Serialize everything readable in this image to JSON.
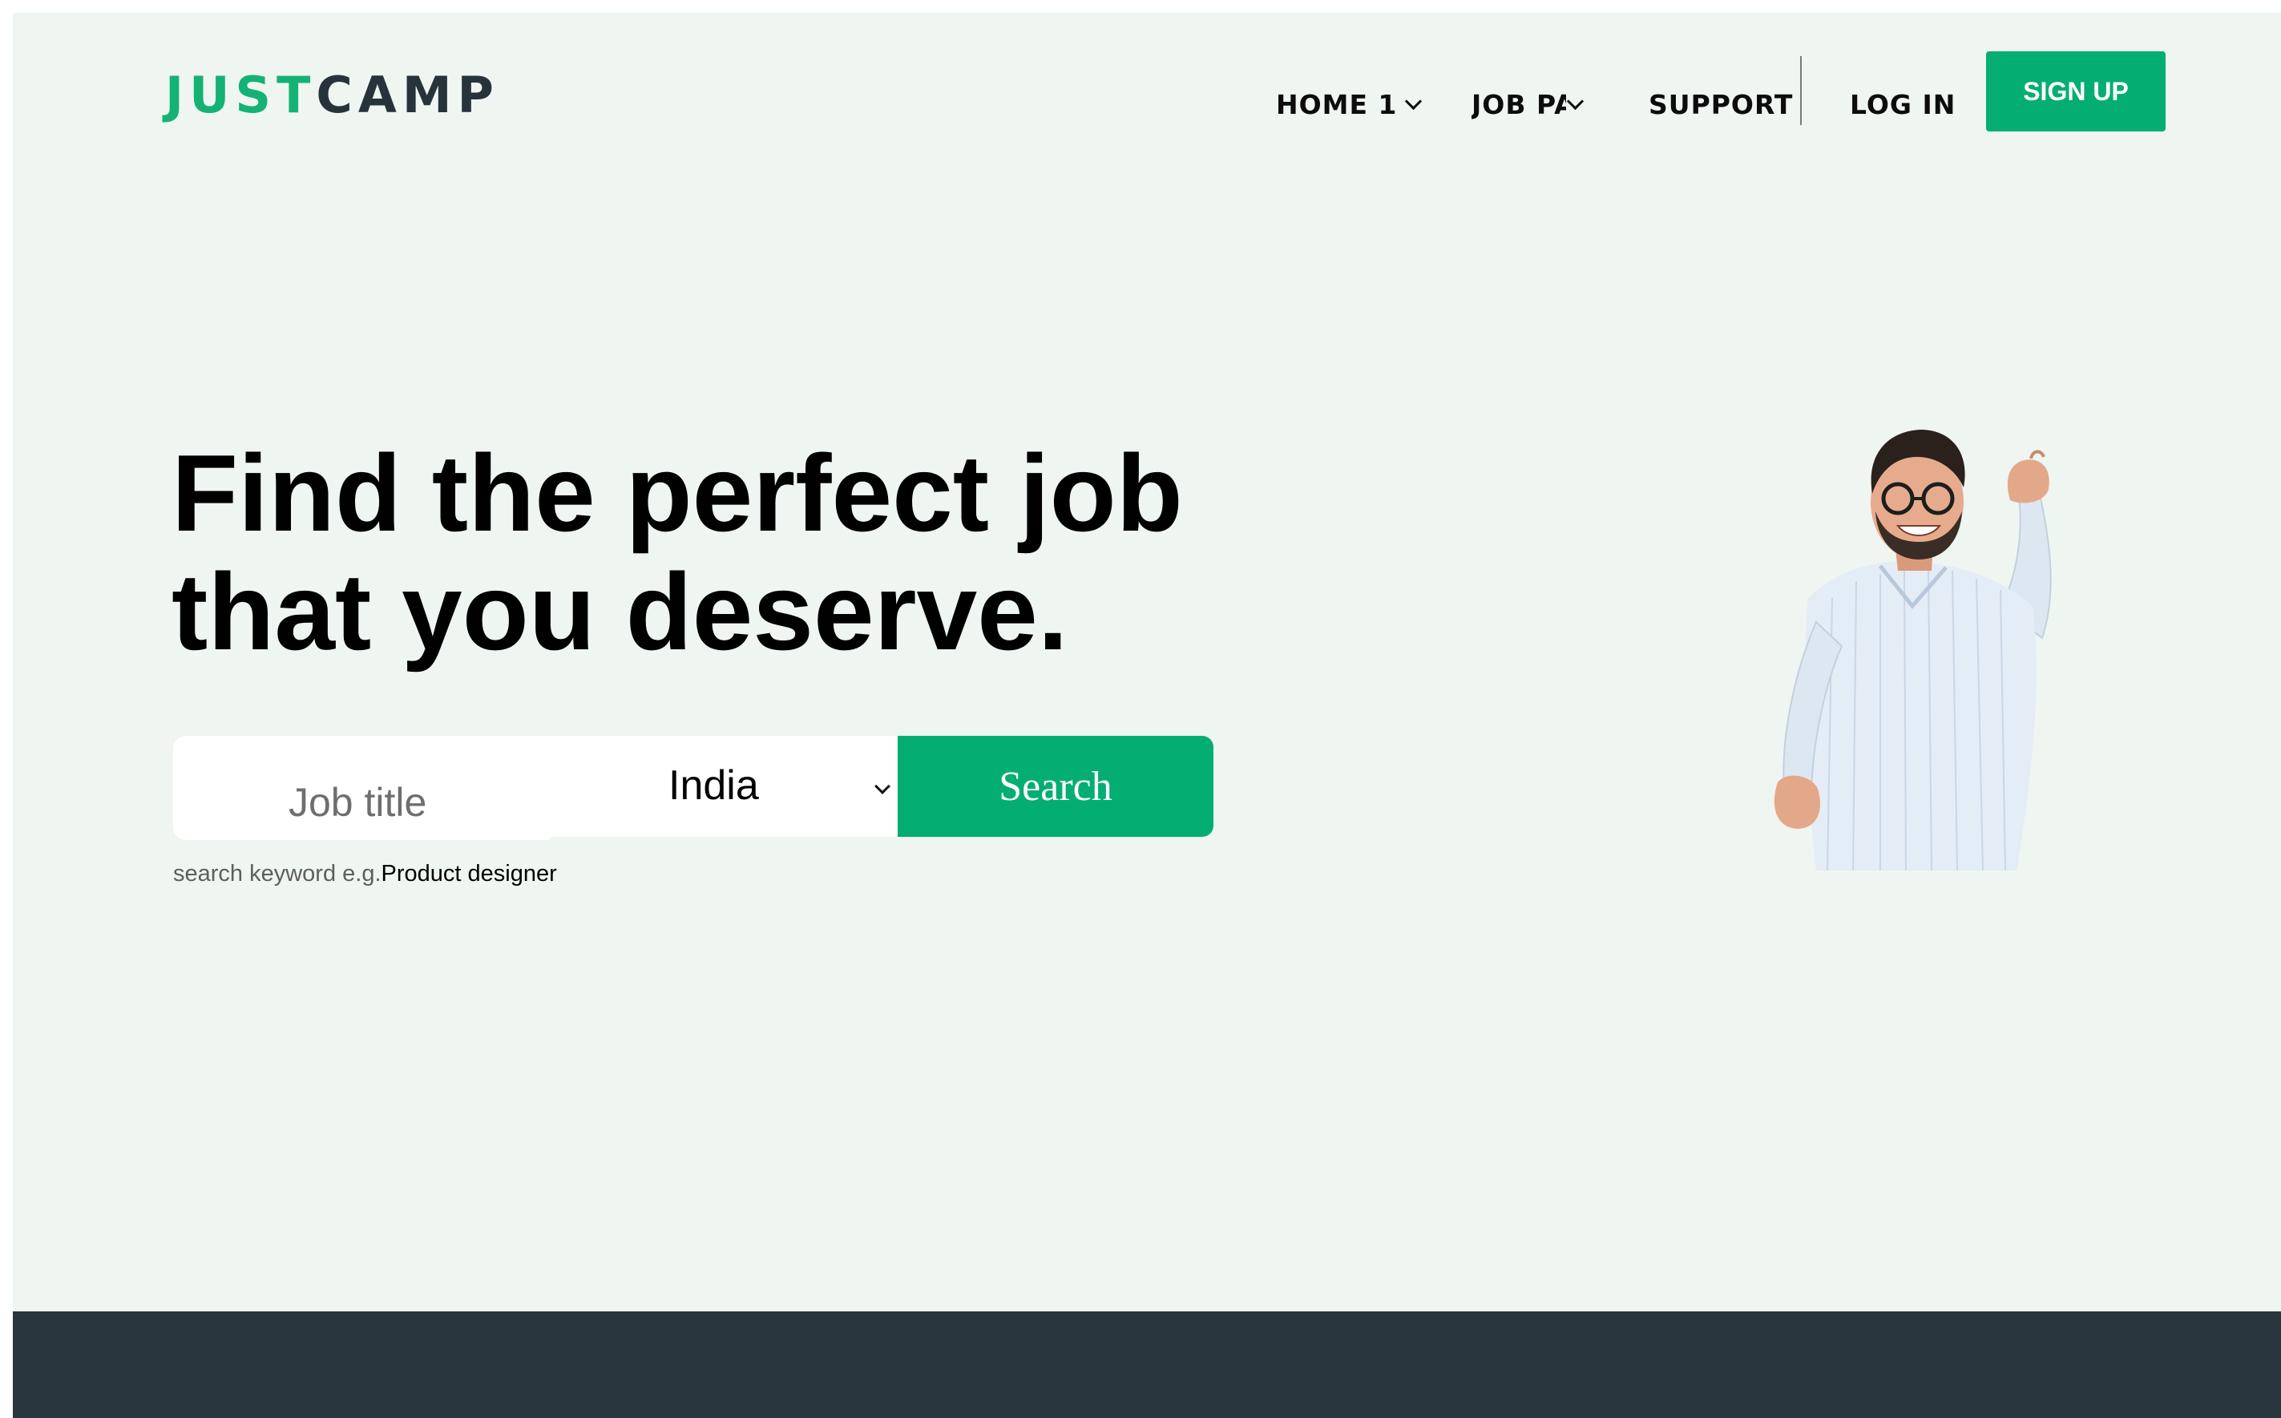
{
  "brand": {
    "logo_part1": "JUST",
    "logo_part2": "CAMP",
    "accent_color": "#04ae72",
    "dark_color": "#26333a"
  },
  "nav": {
    "home": "HOME 1",
    "job_pages": "JOB PAGES",
    "support": "SUPPORT",
    "login": "LOG IN",
    "signup": "SIGN UP"
  },
  "hero": {
    "title_line1": "Find the perfect job",
    "title_line2": "that you deserve."
  },
  "search": {
    "job_placeholder": "Job title",
    "country_value": "India",
    "button_label": "Search",
    "hint_prefix": "search keyword e.g.",
    "hint_example": "Product designer"
  },
  "icons": {
    "home_dropdown": "chevron-down-icon",
    "job_pages_dropdown": "chevron-down-icon",
    "country_dropdown": "chevron-down-icon"
  }
}
